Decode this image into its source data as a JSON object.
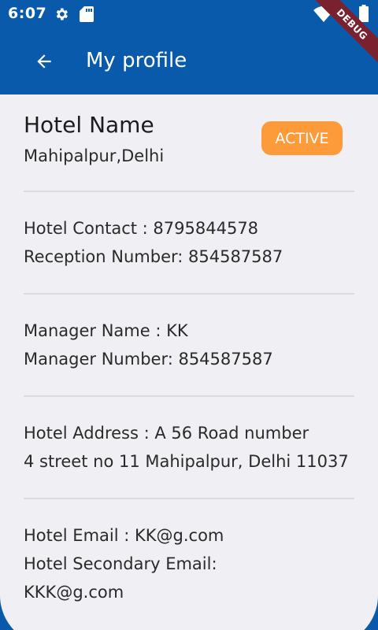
{
  "status_bar": {
    "time": "6:07",
    "icons": [
      "gear-icon",
      "sd-card-icon",
      "wifi-icon",
      "battery-icon"
    ]
  },
  "debug_banner": "DEBUG",
  "app_bar": {
    "title": "My profile",
    "back_icon": "arrow-left-icon",
    "color": "#0a5aab"
  },
  "hotel": {
    "name": "Hotel Name",
    "location": "Mahipalpur,Delhi",
    "status": "ACTIVE",
    "status_color": "#fd9a39"
  },
  "contact": {
    "line1": "Hotel Contact : 8795844578",
    "line2": "Reception Number: 854587587"
  },
  "manager": {
    "line1": "Manager Name : KK",
    "line2": "Manager Number: 854587587"
  },
  "address": {
    "line1": "Hotel Address : A 56 Road number",
    "line2": "4 street no 11 Mahipalpur, Delhi 11037"
  },
  "email": {
    "line1": "Hotel Email : KK@g.com",
    "line2": "Hotel Secondary Email:",
    "line3": "KKK@g.com"
  }
}
